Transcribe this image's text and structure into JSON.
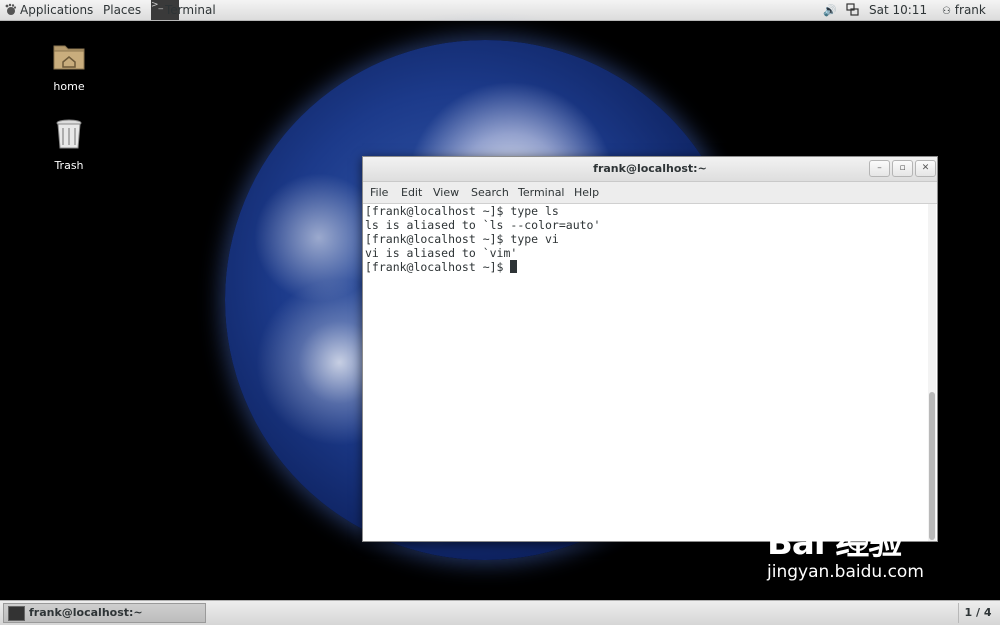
{
  "topbar": {
    "applications": "Applications",
    "places": "Places",
    "terminal_app": "Terminal",
    "clock": "Sat 10:11",
    "user": "frank",
    "volume_icon": "speaker-icon",
    "network_icon": "network-icon"
  },
  "desktop": {
    "icons": [
      {
        "label": "home",
        "icon": "folder-home-icon"
      },
      {
        "label": "Trash",
        "icon": "trash-icon"
      }
    ]
  },
  "terminal": {
    "title": "frank@localhost:~",
    "menu": [
      "File",
      "Edit",
      "View",
      "Search",
      "Terminal",
      "Help"
    ],
    "lines": [
      "[frank@localhost ~]$ type ls",
      "ls is aliased to `ls --color=auto'",
      "[frank@localhost ~]$ type vi",
      "vi is aliased to `vim'",
      "[frank@localhost ~]$ "
    ],
    "buttons": {
      "minimize": "–",
      "maximize": "▫",
      "close": "✕"
    }
  },
  "bottombar": {
    "task_label": "frank@localhost:~",
    "workspace": "1 / 4"
  },
  "watermark": {
    "logo": "Bai  经验",
    "url": "jingyan.baidu.com"
  }
}
